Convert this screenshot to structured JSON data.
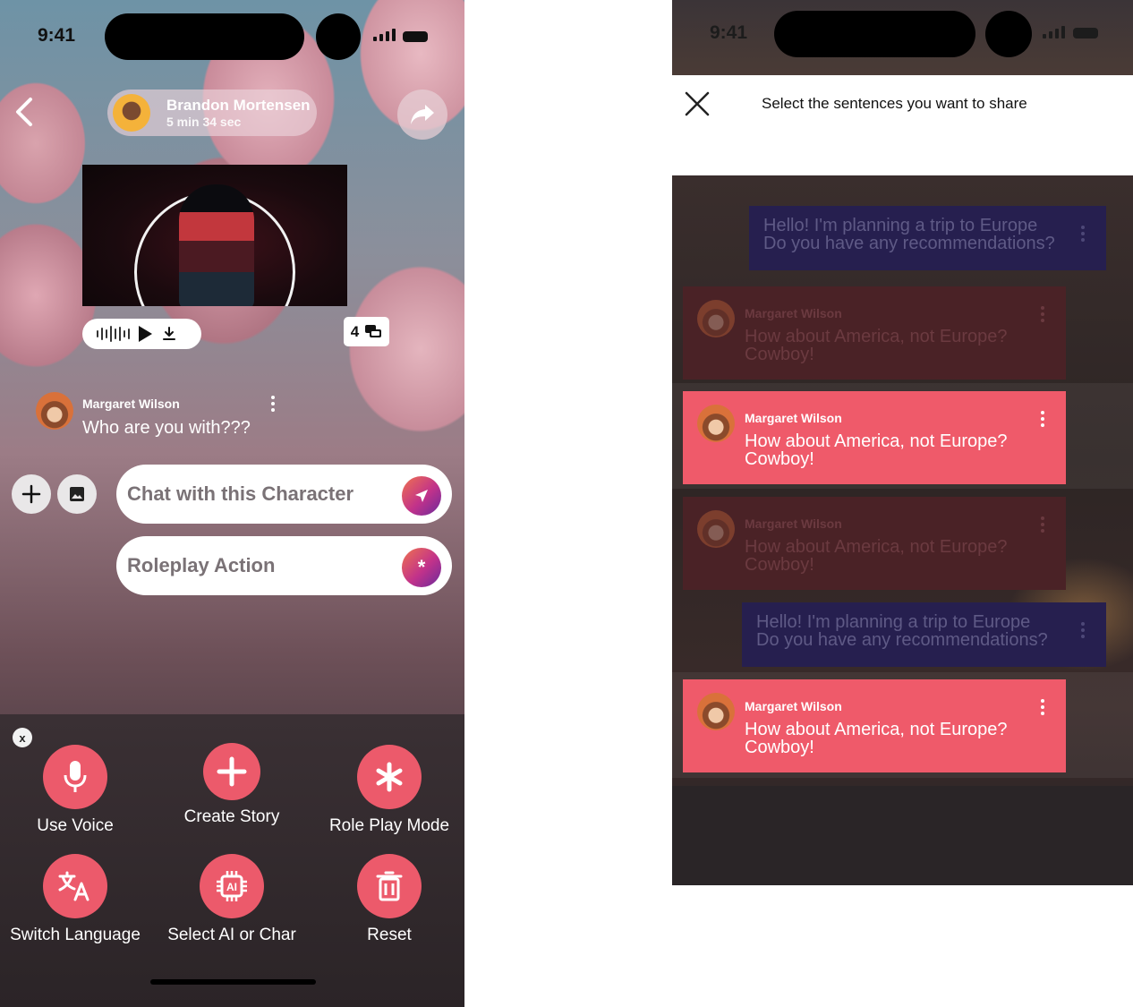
{
  "left_screen": {
    "status": {
      "time": "9:41"
    },
    "header": {
      "contact_name": "Brandon Mortensen",
      "call_duration": "5 min 34 sec"
    },
    "media": {
      "reply_count": "4"
    },
    "message": {
      "author": "Margaret Wilson",
      "text": "Who are you with???"
    },
    "inputs": {
      "chat_placeholder": "Chat with this Character",
      "roleplay_placeholder": "Roleplay Action",
      "roleplay_icon": "*"
    },
    "sheet": {
      "close_label": "x",
      "actions": [
        {
          "label": "Use Voice",
          "icon": "microphone-icon"
        },
        {
          "label": "Create Story",
          "icon": "plus-icon"
        },
        {
          "label": "Role Play Mode",
          "icon": "asterisk-icon"
        },
        {
          "label": "Switch Language",
          "icon": "translate-icon"
        },
        {
          "label": "Select AI or Char",
          "icon": "ai-chip-icon"
        },
        {
          "label": "Reset",
          "icon": "trash-icon"
        }
      ]
    }
  },
  "right_screen": {
    "status": {
      "time": "9:41"
    },
    "title": "Select the sentences you want to share",
    "messages": [
      {
        "type": "user",
        "line1": "Hello! I'm planning a trip to Europe",
        "line2": "Do you have any recommendations?",
        "selected": false
      },
      {
        "type": "character",
        "author": "Margaret Wilson",
        "line1": "How about America, not Europe?",
        "line2": "Cowboy!",
        "selected": false
      },
      {
        "type": "character",
        "author": "Margaret Wilson",
        "line1": "How about America, not Europe?",
        "line2": "Cowboy!",
        "selected": true
      },
      {
        "type": "character",
        "author": "Margaret Wilson",
        "line1": "How about America, not Europe?",
        "line2": "Cowboy!",
        "selected": false
      },
      {
        "type": "user",
        "line1": "Hello! I'm planning a trip to Europe",
        "line2": "Do you have any recommendations?",
        "selected": false
      },
      {
        "type": "character",
        "author": "Margaret Wilson",
        "line1": "How about America, not Europe?",
        "line2": "Cowboy!",
        "selected": true
      }
    ]
  },
  "colors": {
    "accent": "#ec5a6b",
    "selected_bubble": "#ef5a6a",
    "user_bubble": "#261f4f"
  }
}
